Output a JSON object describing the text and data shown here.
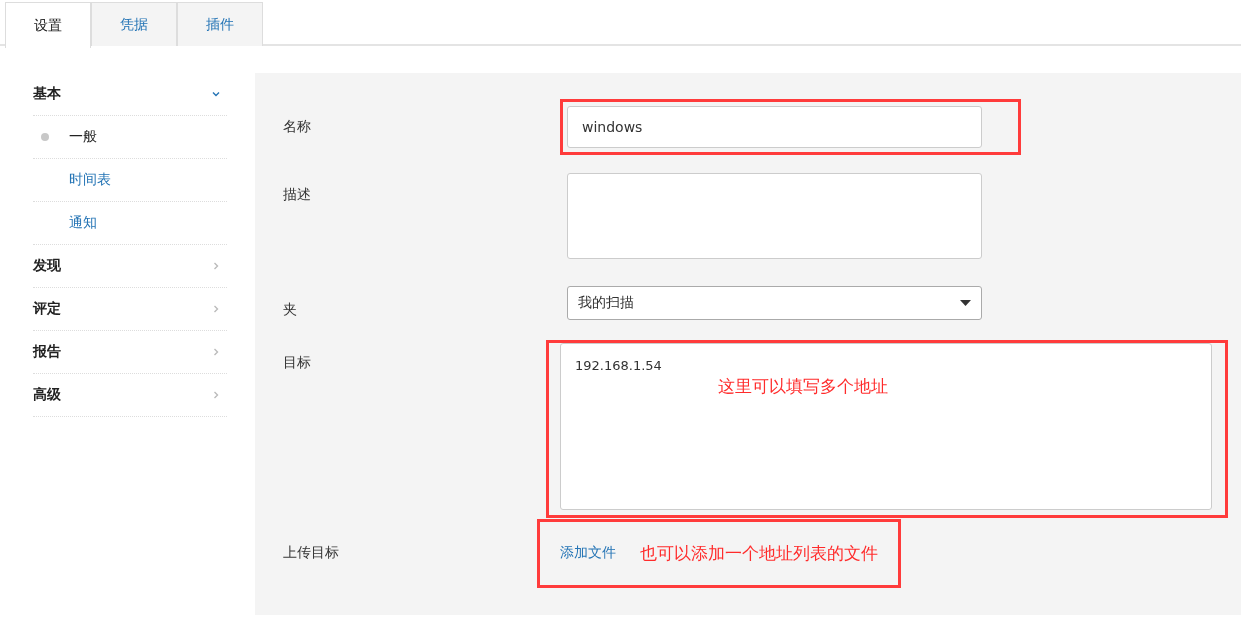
{
  "tabs": [
    {
      "label": "设置",
      "selected": true
    },
    {
      "label": "凭据",
      "selected": false
    },
    {
      "label": "插件",
      "selected": false
    }
  ],
  "sidebar": {
    "sections": [
      {
        "label": "基本",
        "expanded": true,
        "children": [
          {
            "label": "一般",
            "selected": true
          },
          {
            "label": "时间表",
            "selected": false
          },
          {
            "label": "通知",
            "selected": false
          }
        ]
      },
      {
        "label": "发现",
        "expanded": false
      },
      {
        "label": "评定",
        "expanded": false
      },
      {
        "label": "报告",
        "expanded": false
      },
      {
        "label": "高级",
        "expanded": false
      }
    ]
  },
  "form": {
    "fields": [
      {
        "kind": "text",
        "label": "名称",
        "value": "windows",
        "highlighted": true
      },
      {
        "kind": "textarea",
        "label": "描述",
        "highlighted": false
      },
      {
        "kind": "select",
        "label": "夹",
        "value": "我的扫描",
        "highlighted": false
      },
      {
        "kind": "targets",
        "label": "目标",
        "value": "192.168.1.54",
        "highlighted": true,
        "note": "这里可以填写多个地址"
      },
      {
        "kind": "file",
        "label": "上传目标",
        "link": "添加文件",
        "highlighted": true,
        "note": "也可以添加一个地址列表的文件"
      }
    ]
  }
}
